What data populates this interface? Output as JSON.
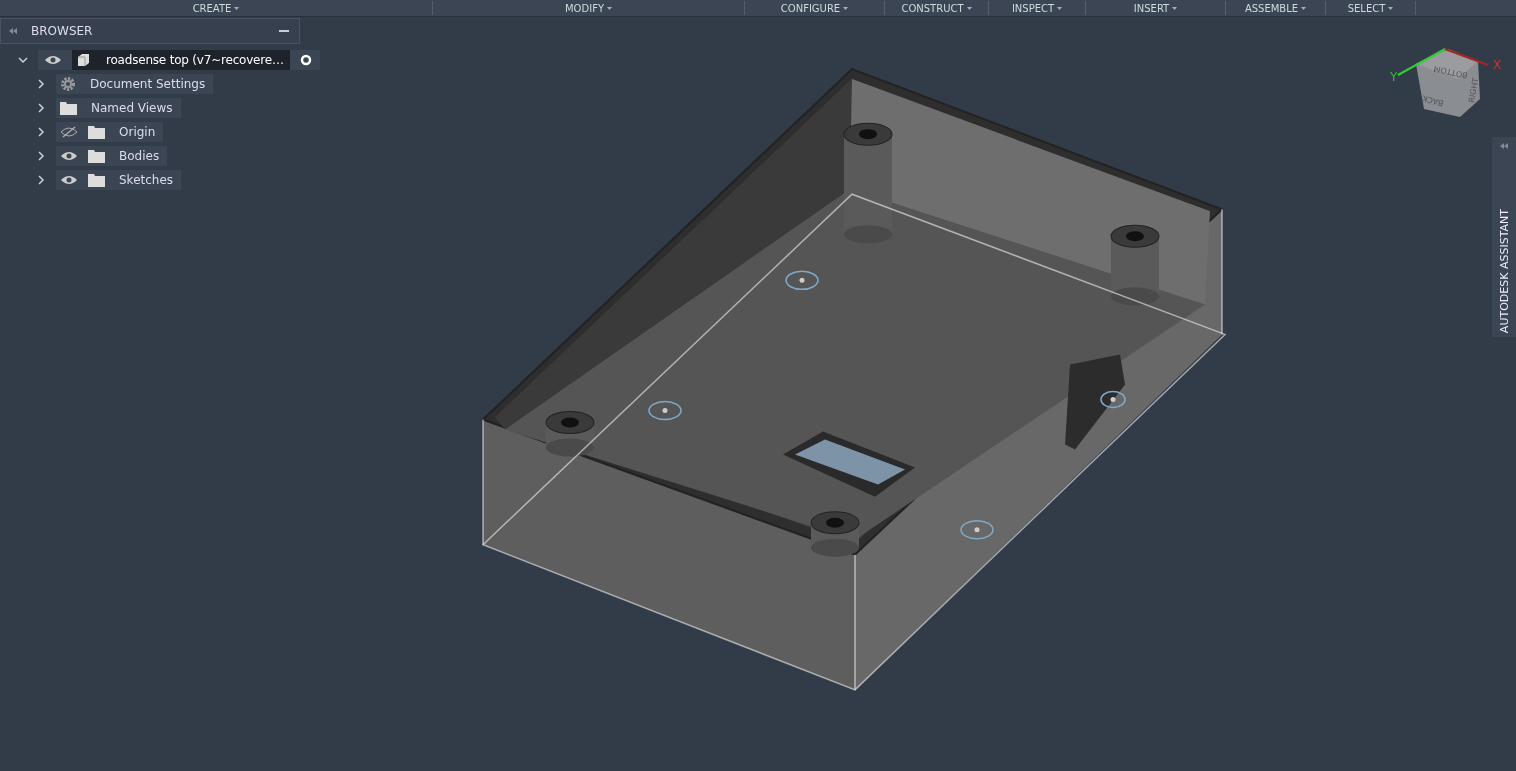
{
  "toolbar": {
    "menus": [
      {
        "label": "CREATE"
      },
      {
        "label": "MODIFY"
      },
      {
        "label": "CONFIGURE"
      },
      {
        "label": "CONSTRUCT"
      },
      {
        "label": "INSPECT"
      },
      {
        "label": "INSERT"
      },
      {
        "label": "ASSEMBLE"
      },
      {
        "label": "SELECT"
      }
    ]
  },
  "browser": {
    "title": "BROWSER",
    "root": {
      "label": "roadsense top (v7~recovere…",
      "expanded": true,
      "visible": true,
      "children": [
        {
          "label": "Document Settings",
          "kind": "settings",
          "expanded": false
        },
        {
          "label": "Named Views",
          "kind": "folder",
          "expanded": false
        },
        {
          "label": "Origin",
          "kind": "folder",
          "expanded": false,
          "visible": false
        },
        {
          "label": "Bodies",
          "kind": "folder",
          "expanded": false,
          "visible": true
        },
        {
          "label": "Sketches",
          "kind": "folder",
          "expanded": false,
          "visible": true
        }
      ]
    }
  },
  "view_cube": {
    "faces": [
      "BOTTOM",
      "BACK",
      "RIGHT"
    ],
    "axes": [
      "X",
      "Y"
    ]
  },
  "side_panel": {
    "title": "AUTODESK ASSISTANT"
  }
}
